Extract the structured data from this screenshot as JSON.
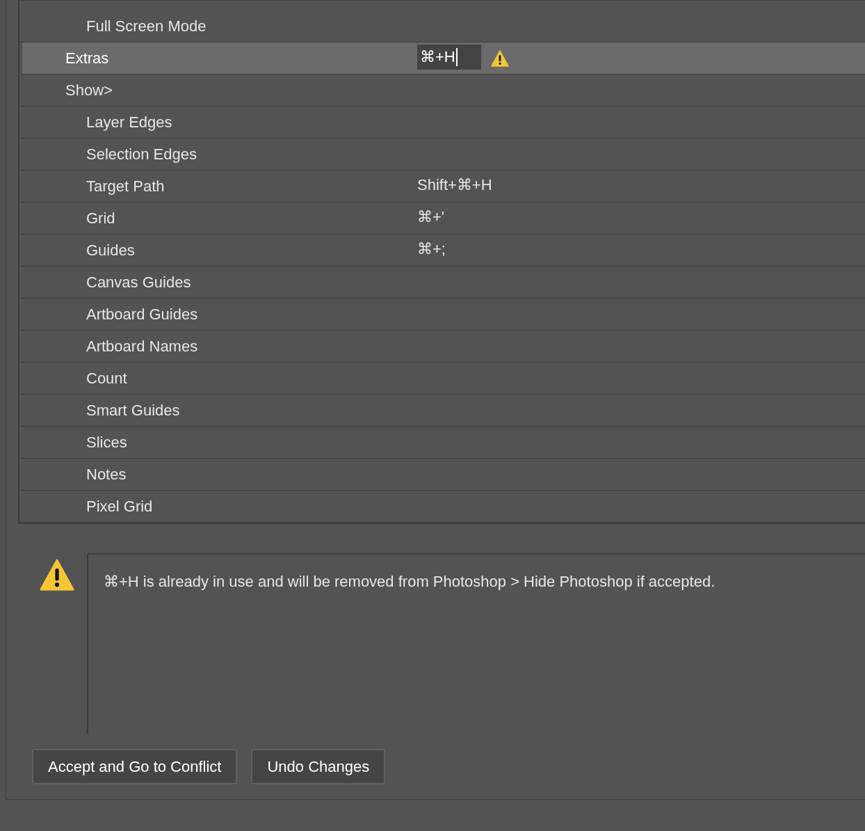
{
  "shortcuts": {
    "rows_above": [
      {
        "label": "Full Screen Mode",
        "selected": false
      }
    ],
    "rows": [
      {
        "label": "Extras",
        "selected": true,
        "shortcut": "⌘+H",
        "editing": true,
        "conflict": true
      },
      {
        "label": "Show>",
        "selected": false,
        "children": [
          {
            "label": "Layer Edges",
            "selected": false
          },
          {
            "label": "Selection Edges",
            "selected": false
          },
          {
            "label": "Target Path",
            "selected": false,
            "shortcut": "Shift+⌘+H"
          },
          {
            "label": "Grid",
            "selected": false,
            "shortcut": "⌘+'"
          },
          {
            "label": "Guides",
            "selected": false,
            "shortcut": "⌘+;"
          },
          {
            "label": "Canvas Guides",
            "selected": false
          },
          {
            "label": "Artboard Guides",
            "selected": false
          },
          {
            "label": "Artboard Names",
            "selected": false
          },
          {
            "label": "Count",
            "selected": false
          },
          {
            "label": "Smart Guides",
            "selected": false
          },
          {
            "label": "Slices",
            "selected": false
          },
          {
            "label": "Notes",
            "selected": false
          },
          {
            "label": "Pixel Grid",
            "selected": false
          }
        ]
      }
    ]
  },
  "conflict_message": "⌘+H is already in use and will be removed from Photoshop > Hide Photoshop if accepted.",
  "buttons": [
    "Accept and Go to Conflict",
    "Undo Changes"
  ]
}
